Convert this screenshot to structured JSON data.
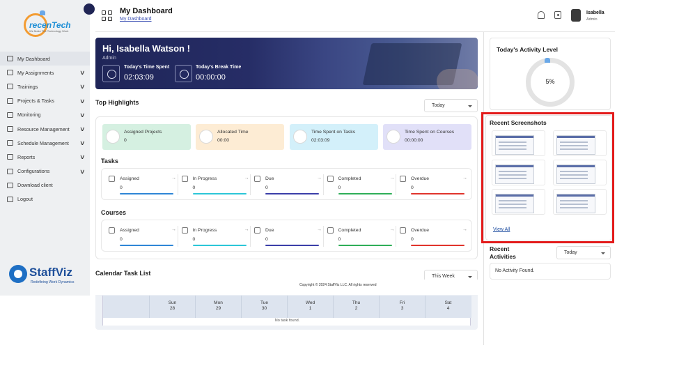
{
  "brand_top": {
    "name": "recenTech",
    "tagline": "We Make The Technology Work"
  },
  "brand_bottom": {
    "name": "StaffViz",
    "slogan": "Redefining Work Dynamics"
  },
  "sidebar": {
    "items": [
      {
        "label": "My Dashboard",
        "has_chevron": false
      },
      {
        "label": "My Assignments",
        "has_chevron": true
      },
      {
        "label": "Trainings",
        "has_chevron": true
      },
      {
        "label": "Projects & Tasks",
        "has_chevron": true
      },
      {
        "label": "Monitoring",
        "has_chevron": true
      },
      {
        "label": "Resource Management",
        "has_chevron": true
      },
      {
        "label": "Schedule Management",
        "has_chevron": true
      },
      {
        "label": "Reports",
        "has_chevron": true
      },
      {
        "label": "Configurations",
        "has_chevron": true
      },
      {
        "label": "Download client",
        "has_chevron": false
      },
      {
        "label": "Logout",
        "has_chevron": false
      }
    ]
  },
  "header": {
    "title": "My Dashboard",
    "breadcrumb": "My Dashboard",
    "user_name": "Isabella",
    "user_role": "Admin"
  },
  "banner": {
    "greeting": "Hi, Isabella Watson !",
    "role": "Admin",
    "time_spent_label": "Today's Time Spent",
    "time_spent_value": "02:03:09",
    "break_label": "Today's Break Time",
    "break_value": "00:00:00"
  },
  "highlights": {
    "title": "Top Highlights",
    "filter": "Today",
    "cards": [
      {
        "label": "Assigned Projects",
        "value": "0",
        "color": "#d5f0e1"
      },
      {
        "label": "Allocated Time",
        "value": "00:00",
        "color": "#fdecd4"
      },
      {
        "label": "Time Spent on Tasks",
        "value": "02:03:09",
        "color": "#d3f0fa"
      },
      {
        "label": "Time Spent on Courses",
        "value": "00:00:00",
        "color": "#e1e0f8"
      }
    ]
  },
  "tasks": {
    "title": "Tasks",
    "items": [
      {
        "label": "Assigned",
        "value": "0",
        "color": "#2f86d6"
      },
      {
        "label": "In Progress",
        "value": "0",
        "color": "#2cc6d8"
      },
      {
        "label": "Due",
        "value": "0",
        "color": "#3b3fa8"
      },
      {
        "label": "Completed",
        "value": "0",
        "color": "#2fae58"
      },
      {
        "label": "Overdue",
        "value": "0",
        "color": "#e0342c"
      }
    ]
  },
  "courses": {
    "title": "Courses",
    "items": [
      {
        "label": "Assigned",
        "value": "0",
        "color": "#2f86d6"
      },
      {
        "label": "In Progress",
        "value": "0",
        "color": "#2cc6d8"
      },
      {
        "label": "Due",
        "value": "0",
        "color": "#3b3fa8"
      },
      {
        "label": "Completed",
        "value": "0",
        "color": "#2fae58"
      },
      {
        "label": "Overdue",
        "value": "0",
        "color": "#e0342c"
      }
    ]
  },
  "calendar": {
    "title": "Calendar Task List",
    "filter": "This Week",
    "days": [
      {
        "name": "Sun",
        "date": "28"
      },
      {
        "name": "Mon",
        "date": "29"
      },
      {
        "name": "Tue",
        "date": "30"
      },
      {
        "name": "Wed",
        "date": "1"
      },
      {
        "name": "Thu",
        "date": "2"
      },
      {
        "name": "Fri",
        "date": "3"
      },
      {
        "name": "Sat",
        "date": "4"
      }
    ],
    "empty": "No task found."
  },
  "footer": {
    "copyright": "Copyright © 2024 StaffViz LLC. All rights reserved"
  },
  "activity": {
    "title": "Today's Activity Level",
    "value": "5%",
    "percent": 5
  },
  "screenshots": {
    "title": "Recent Screenshots",
    "view_all": "View All",
    "count": 6
  },
  "recent_activities": {
    "title": "Recent Activities",
    "filter": "Today",
    "empty": "No Activity Found."
  },
  "colors": {
    "accent": "#1f2558",
    "highlight_box": "#e31b1b",
    "link": "#1f4ea0"
  }
}
